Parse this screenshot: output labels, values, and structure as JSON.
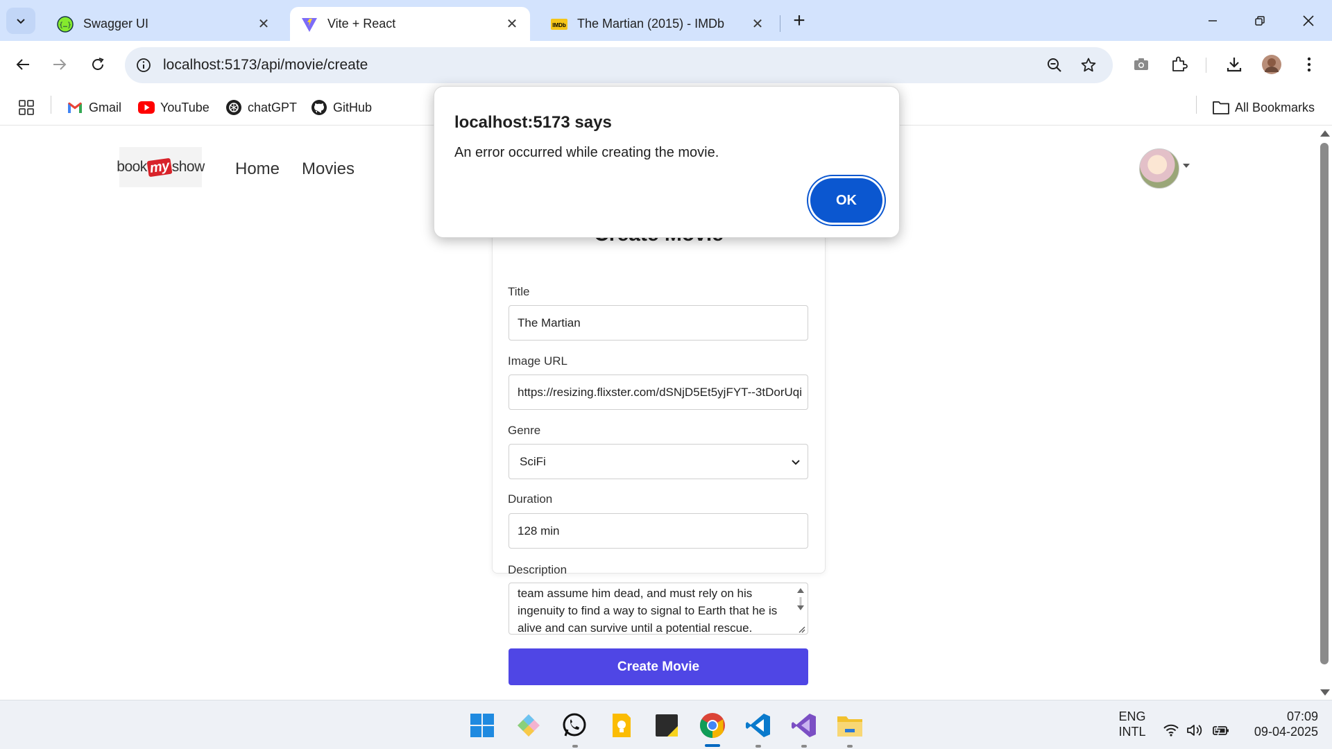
{
  "browser": {
    "tabs": [
      {
        "label": "Swagger UI",
        "active": false,
        "favicon": "swagger-icon"
      },
      {
        "label": "Vite + React",
        "active": true,
        "favicon": "vite-icon"
      },
      {
        "label": "The Martian (2015) - IMDb",
        "active": false,
        "favicon": "imdb-icon"
      }
    ],
    "tab_close_glyph": "✕",
    "new_tab_glyph": "+",
    "url": "localhost:5173/api/movie/create",
    "bookmarks": [
      {
        "label": "Gmail",
        "icon": "gmail-icon"
      },
      {
        "label": "YouTube",
        "icon": "youtube-icon"
      },
      {
        "label": "chatGPT",
        "icon": "chatgpt-icon"
      },
      {
        "label": "GitHub",
        "icon": "github-icon"
      }
    ],
    "all_bookmarks": "All Bookmarks"
  },
  "site": {
    "logo": {
      "left": "book",
      "mid": "my",
      "right": "show"
    },
    "nav": [
      "Home",
      "Movies"
    ]
  },
  "form": {
    "heading": "Create Movie",
    "fields": {
      "title": {
        "label": "Title",
        "value": "The Martian"
      },
      "image_url": {
        "label": "Image URL",
        "value": "https://resizing.flixster.com/dSNjD5Et5yjFYT--3tDorUqi"
      },
      "genre": {
        "label": "Genre",
        "value": "SciFi"
      },
      "duration": {
        "label": "Duration",
        "value": "128 min"
      },
      "description": {
        "label": "Description",
        "lines": [
          "team assume him dead, and must rely on his",
          "ingenuity to find a way to signal to Earth that he is",
          "alive and can survive until a potential rescue."
        ]
      }
    },
    "submit_label": "Create Movie"
  },
  "dialog": {
    "title": "localhost:5173 says",
    "message": "An error occurred while creating the movie.",
    "ok_label": "OK"
  },
  "taskbar": {
    "apps": [
      "start-icon",
      "git-icon",
      "whatsapp-icon",
      "keep-icon",
      "sticky-notes-icon",
      "chrome-icon",
      "vscode-icon",
      "visual-studio-icon",
      "file-explorer-icon"
    ],
    "lang_top": "ENG",
    "lang_bottom": "INTL",
    "time": "07:09",
    "date": "09-04-2025"
  },
  "colors": {
    "accent_button": "#4f46e5",
    "dialog_ok": "#0b57d0",
    "tabstrip": "#d3e3fd"
  }
}
